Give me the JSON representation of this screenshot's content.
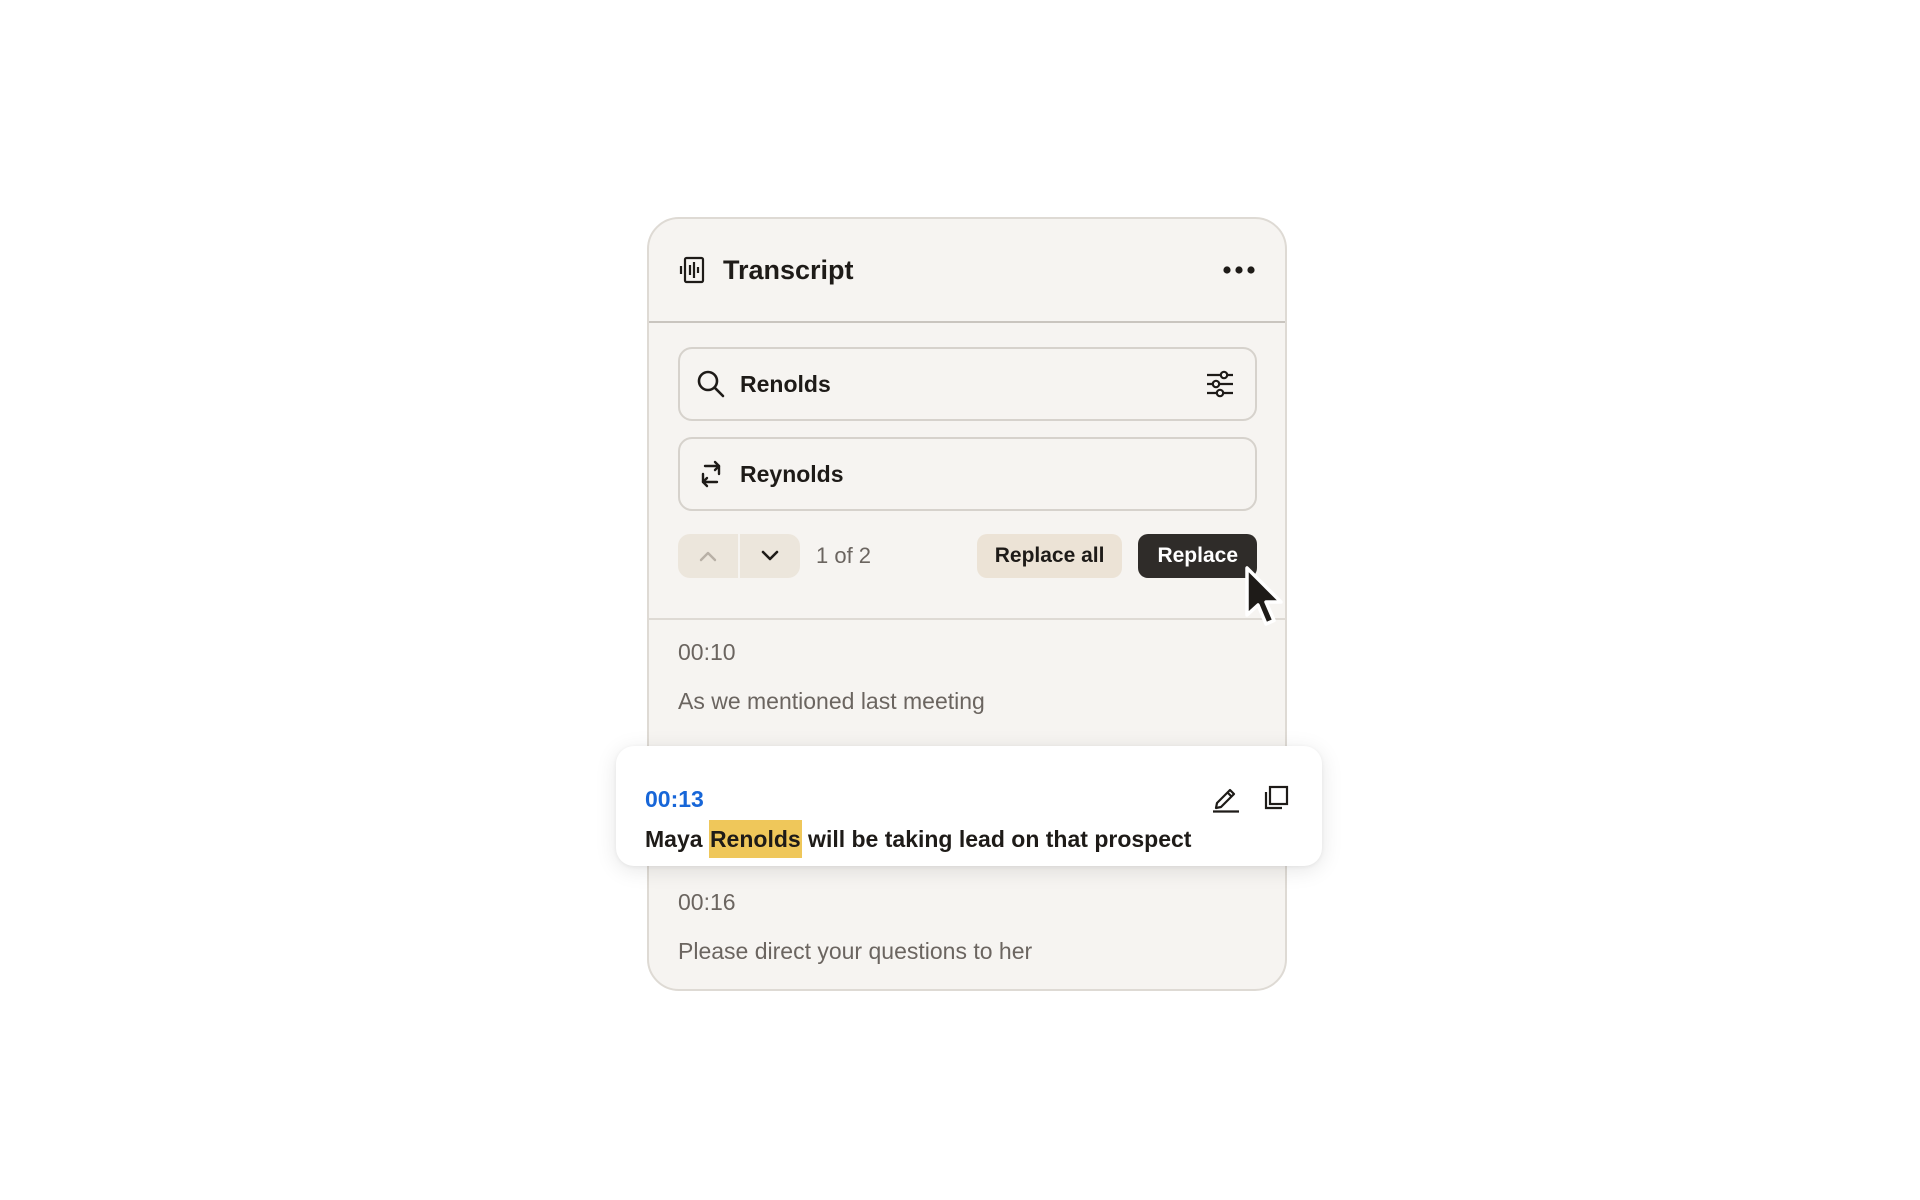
{
  "header": {
    "title": "Transcript",
    "title_icon": "transcript-icon",
    "menu_icon": "more-horizontal-icon"
  },
  "search": {
    "value": "Renolds",
    "icon": "search-icon",
    "filter_icon": "sliders-icon"
  },
  "replace": {
    "value": "Reynolds",
    "icon": "swap-arrows-icon"
  },
  "navigation": {
    "prev_icon": "chevron-up-icon",
    "next_icon": "chevron-down-icon",
    "match_count": "1 of 2",
    "replace_all_label": "Replace all",
    "replace_label": "Replace"
  },
  "segments": [
    {
      "time": "00:10",
      "text": "As we mentioned last meeting"
    },
    {
      "time": "00:13",
      "text_before": "Maya ",
      "text_match": "Renolds",
      "text_after": " will be taking lead on that prospect",
      "edit_icon": "pencil-icon",
      "copy_icon": "copy-icon"
    },
    {
      "time": "00:16",
      "text": "Please direct your questions to her"
    }
  ],
  "colors": {
    "panel_bg": "#f6f4f1",
    "accent_time": "#1766d8",
    "highlight": "#efc75a",
    "primary_button": "#2f2c29",
    "secondary_button": "#ece3d6"
  }
}
